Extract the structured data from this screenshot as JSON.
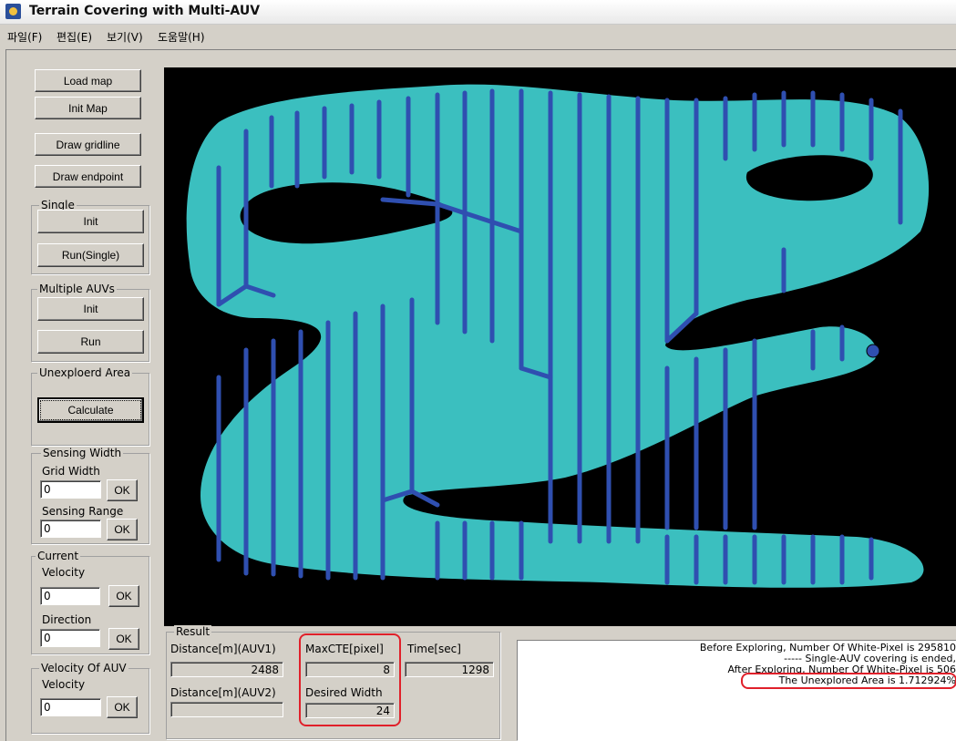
{
  "window": {
    "title": "Terrain Covering with Multi-AUV"
  },
  "menu": [
    "파일(F)",
    "편집(E)",
    "보기(V)",
    "도움말(H)"
  ],
  "menu_accel": [
    "F",
    "E",
    "V",
    "H"
  ],
  "buttons": {
    "load_map": "Load map",
    "init_map": "Init Map",
    "draw_gridline": "Draw gridline",
    "draw_endpoint": "Draw endpoint"
  },
  "single": {
    "label": "Single",
    "init": "Init",
    "run": "Run(Single)"
  },
  "multi": {
    "label": "Multiple AUVs",
    "init": "Init",
    "run": "Run"
  },
  "unexplored": {
    "label": "Unexploerd Area",
    "calculate": "Calculate"
  },
  "sensing": {
    "label": "Sensing Width",
    "grid_width_label": "Grid Width",
    "grid_width_value": "0",
    "ok1": "OK",
    "range_label": "Sensing Range",
    "range_value": "0",
    "ok2": "OK"
  },
  "current": {
    "label": "Current",
    "velocity_label": "Velocity",
    "velocity_value": "0",
    "ok1": "OK",
    "direction_label": "Direction",
    "direction_value": "0",
    "ok2": "OK"
  },
  "auv_velocity": {
    "label": "Velocity Of AUV",
    "velocity_label": "Velocity",
    "velocity_value": "0",
    "ok": "OK"
  },
  "result": {
    "label": "Result",
    "dist1_label": "Distance[m](AUV1)",
    "dist1_value": "2488",
    "dist2_label": "Distance[m](AUV2)",
    "dist2_value": "",
    "maxcte_label": "MaxCTE[pixel]",
    "maxcte_value": "8",
    "desired_label": "Desired Width",
    "desired_value": "24",
    "time_label": "Time[sec]",
    "time_value": "1298"
  },
  "log": [
    "Before Exploring, Number Of White-Pixel is 295810",
    "----- Single-AUV covering is ended,",
    "After Exploring, Number Of White-Pixel is 506",
    "The Unexplored Area is 1.712924%"
  ],
  "colors": {
    "terrain": "#3bbfbf",
    "path": "#2f4fb0",
    "background": "#000000",
    "highlight": "#e0202a"
  }
}
